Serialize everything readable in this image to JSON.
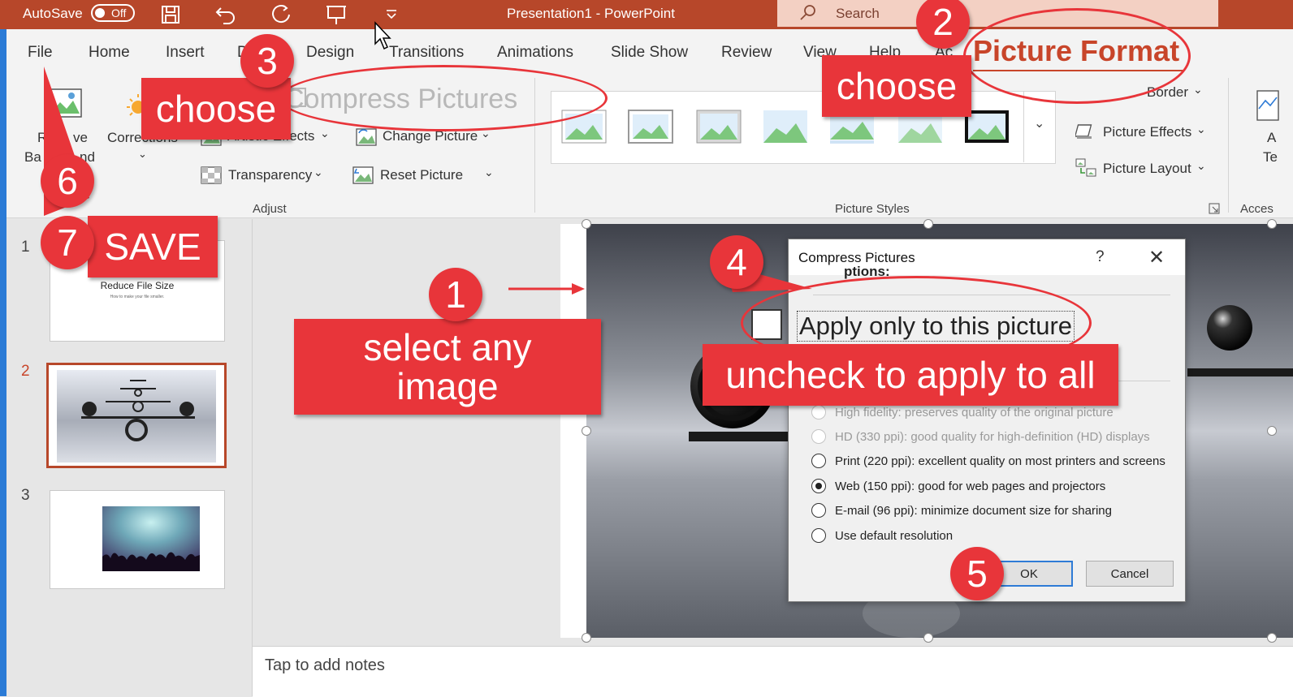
{
  "titlebar": {
    "autosave_label": "AutoSave",
    "autosave_state": "Off",
    "title": "Presentation1  -  PowerPoint",
    "search_placeholder": "Search",
    "accent_color": "#b7472a"
  },
  "tabs": [
    "File",
    "Home",
    "Insert",
    "D",
    "Design",
    "Transitions",
    "Animations",
    "Slide Show",
    "Review",
    "View",
    "Help",
    "Ac",
    "Picture Format"
  ],
  "ribbon": {
    "remove_bg_top": "R",
    "remove_bg_mid": "ve",
    "remove_bg_bottom_a": "Ba",
    "remove_bg_bottom_b": "nd",
    "corrections": "Corrections",
    "compress_pictures": "Compress Pictures",
    "artistic_effects": "Artistic Effects",
    "change_picture": "Change Picture",
    "transparency": "Transparency",
    "reset_picture": "Reset Picture",
    "adjust_caption": "Adjust",
    "picture_styles_caption": "Picture Styles",
    "picture_border": "Border",
    "picture_effects": "Picture Effects",
    "picture_layout": "Picture Layout",
    "accessibility_caption": "Acces",
    "alt_text_a": "A",
    "alt_text_b": "Te"
  },
  "slides": [
    {
      "number": "1",
      "title": "Reduce File Size",
      "subtitle": "How to make your file smaller."
    },
    {
      "number": "2"
    },
    {
      "number": "3"
    }
  ],
  "notes_placeholder": "Tap to add notes",
  "dialog": {
    "title": "Compress Pictures",
    "help": "?",
    "partial_heading": "ptions:",
    "apply_only": "Apply only to this picture",
    "options": [
      {
        "label": "High fidelity: preserves quality of the original picture",
        "selected": false,
        "disabled": true
      },
      {
        "label": "HD (330 ppi): good quality for high-definition (HD) displays",
        "selected": false,
        "disabled": true
      },
      {
        "label": "Print (220 ppi): excellent quality on most printers and screens",
        "selected": false,
        "disabled": false
      },
      {
        "label": "Web (150 ppi): good for web pages and projectors",
        "selected": true,
        "disabled": false
      },
      {
        "label": "E-mail (96 ppi): minimize document size for sharing",
        "selected": false,
        "disabled": false
      },
      {
        "label": "Use default resolution",
        "selected": false,
        "disabled": false
      }
    ],
    "ok": "OK",
    "cancel": "Cancel"
  },
  "annotations": {
    "badge_1": "1",
    "badge_2": "2",
    "badge_3": "3",
    "badge_4": "4",
    "badge_5": "5",
    "badge_6": "6",
    "badge_7": "7",
    "choose_left": "choose",
    "choose_right": "choose",
    "picture_format_callout": "Picture Format",
    "compress_callout": "Compress Pictures",
    "select_any_image": "select any image",
    "uncheck_to_apply_all": "uncheck to apply to all",
    "save": "SAVE",
    "annotation_color": "#e8353a"
  }
}
